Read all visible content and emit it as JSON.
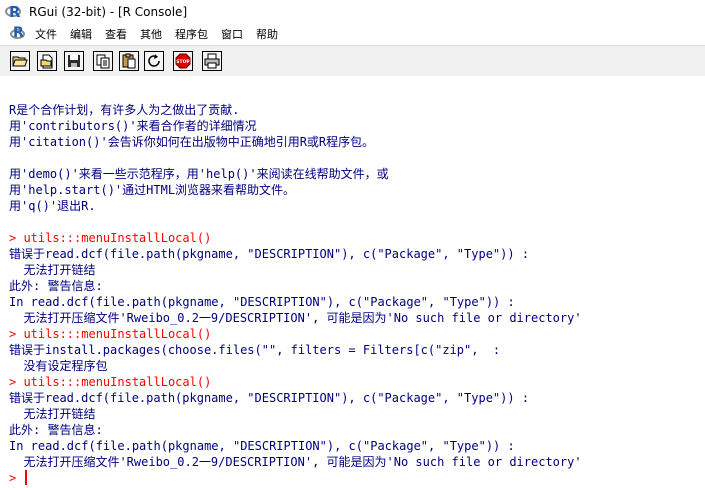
{
  "window": {
    "title": "RGui (32-bit) - [R Console]"
  },
  "menu": {
    "items": [
      "文件",
      "编辑",
      "查看",
      "其他",
      "程序包",
      "窗口",
      "帮助"
    ]
  },
  "toolbar": {
    "buttons": [
      "open-script",
      "load-workspace",
      "save-workspace",
      "copy",
      "paste",
      "copy-paste",
      "stop",
      "print"
    ],
    "stop_label": "STOP"
  },
  "console": {
    "lines": [
      {
        "text": "R是个合作计划，有许多人为之做出了贡献.",
        "kind": "output"
      },
      {
        "text": "用'contributors()'来看合作者的详细情况",
        "kind": "output"
      },
      {
        "text": "用'citation()'会告诉你如何在出版物中正确地引用R或R程序包。",
        "kind": "output"
      },
      {
        "text": "",
        "kind": "blank"
      },
      {
        "text": "用'demo()'来看一些示范程序，用'help()'来阅读在线帮助文件，或",
        "kind": "output"
      },
      {
        "text": "用'help.start()'通过HTML浏览器来看帮助文件。",
        "kind": "output"
      },
      {
        "text": "用'q()'退出R.",
        "kind": "output"
      },
      {
        "text": "",
        "kind": "blank"
      },
      {
        "text": "> utils:::menuInstallLocal()",
        "kind": "input"
      },
      {
        "text": "错误于read.dcf(file.path(pkgname, \"DESCRIPTION\"), c(\"Package\", \"Type\")) :",
        "kind": "output"
      },
      {
        "text": "  无法打开链结",
        "kind": "output"
      },
      {
        "text": "此外: 警告信息:",
        "kind": "output"
      },
      {
        "text": "In read.dcf(file.path(pkgname, \"DESCRIPTION\"), c(\"Package\", \"Type\")) :",
        "kind": "output"
      },
      {
        "text": "  无法打开压缩文件'Rweibo_0.2一9/DESCRIPTION', 可能是因为'No such file or directory'",
        "kind": "output"
      },
      {
        "text": "> utils:::menuInstallLocal()",
        "kind": "input"
      },
      {
        "text": "错误于install.packages(choose.files(\"\", filters = Filters[c(\"zip\",  :",
        "kind": "output"
      },
      {
        "text": "  没有设定程序包",
        "kind": "output"
      },
      {
        "text": "> utils:::menuInstallLocal()",
        "kind": "input"
      },
      {
        "text": "错误于read.dcf(file.path(pkgname, \"DESCRIPTION\"), c(\"Package\", \"Type\")) :",
        "kind": "output"
      },
      {
        "text": "  无法打开链结",
        "kind": "output"
      },
      {
        "text": "此外: 警告信息:",
        "kind": "output"
      },
      {
        "text": "In read.dcf(file.path(pkgname, \"DESCRIPTION\"), c(\"Package\", \"Type\")) :",
        "kind": "output"
      },
      {
        "text": "  无法打开压缩文件'Rweibo_0.2一9/DESCRIPTION', 可能是因为'No such file or directory'",
        "kind": "output"
      }
    ],
    "prompt": ">",
    "colors": {
      "output": "#000080",
      "input": "#ff0000"
    }
  }
}
